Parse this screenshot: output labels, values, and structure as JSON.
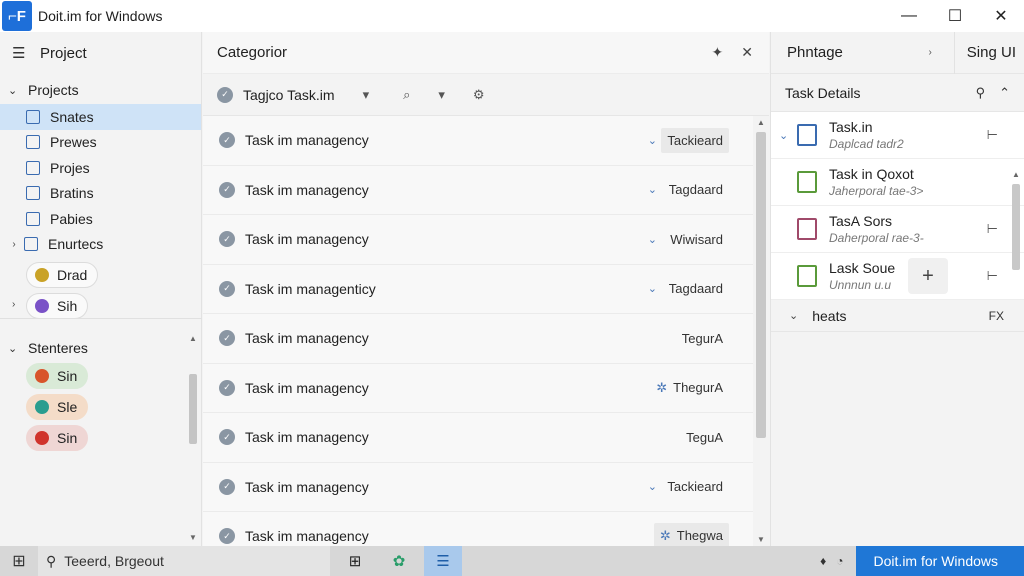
{
  "window": {
    "title": "Doit.im for Windows",
    "controls": [
      "—",
      "☐",
      "✕"
    ]
  },
  "sidebar": {
    "header": "Project",
    "projects_label": "Projects",
    "items": [
      {
        "label": "Snates",
        "selected": true
      },
      {
        "label": "Prewes",
        "selected": false
      },
      {
        "label": "Projes",
        "selected": false
      },
      {
        "label": "Bratins",
        "selected": false
      },
      {
        "label": "Pabies",
        "selected": false
      },
      {
        "label": "Enurtecs",
        "selected": false,
        "expandable": true
      }
    ],
    "pills_top": [
      {
        "label": "Drad",
        "color": "#c9a227"
      },
      {
        "label": "Sih",
        "color": "#7a52c7"
      }
    ],
    "stenters_label": "Stenteres",
    "pills_bottom": [
      {
        "label": "Sin",
        "bg": "#d9ead7",
        "color": "#d8552a"
      },
      {
        "label": "Sle",
        "bg": "#f4dcc8",
        "color": "#2a9d8f"
      },
      {
        "label": "Sin",
        "bg": "#efd6d4",
        "color": "#d0342c"
      }
    ]
  },
  "center": {
    "header_title": "Categorior",
    "header_pin": "✦",
    "header_close": "✕",
    "toolbar_label": "Tagjco Task.im",
    "toolbar_dropdown": "▾",
    "toolbar_search": "⌕",
    "toolbar_filter": "▾",
    "toolbar_settings": "⚙",
    "tasks": [
      {
        "name": "Task im managency",
        "tag": "Tackieard",
        "chev": true,
        "boxed": true,
        "tagicon": ""
      },
      {
        "name": "Task im managency",
        "tag": "Tagdaard",
        "chev": true,
        "boxed": false,
        "tagicon": ""
      },
      {
        "name": "Task im managency",
        "tag": "Wiwisard",
        "chev": true,
        "boxed": false,
        "tagicon": ""
      },
      {
        "name": "Task im managenticy",
        "tag": "Tagdaard",
        "chev": true,
        "boxed": false,
        "tagicon": ""
      },
      {
        "name": "Task im managency",
        "tag": "TegurA",
        "chev": false,
        "boxed": false,
        "tagicon": ""
      },
      {
        "name": "Task im managency",
        "tag": "ThegurA",
        "chev": false,
        "boxed": false,
        "tagicon": "✲"
      },
      {
        "name": "Task im managency",
        "tag": "TeguA",
        "chev": false,
        "boxed": false,
        "tagicon": ""
      },
      {
        "name": "Task im managency",
        "tag": "Tackieard",
        "chev": true,
        "boxed": false,
        "tagicon": ""
      },
      {
        "name": "Task im managency",
        "tag": "Thegwa",
        "chev": false,
        "boxed": true,
        "tagicon": "✲"
      }
    ]
  },
  "right": {
    "header_title": "Phntage",
    "header_mid": "›",
    "header_side": "Sing UI",
    "sub_title": "Task Details",
    "sub_pin": "⚲",
    "sub_collapse": "⌃",
    "details": [
      {
        "t1": "Task.in",
        "t2": "Daplcad tadr2",
        "border": "#3a6bb0",
        "flag": "⊢",
        "chev": true
      },
      {
        "t1": "Task in Qoxot",
        "t2": "Jaherporal tae-3>",
        "border": "#5a9a3a",
        "flag": "",
        "chev": false
      },
      {
        "t1": "TasA Sors",
        "t2": "Daherporal rae-3-",
        "border": "#a04a6a",
        "flag": "⊢",
        "chev": false
      },
      {
        "t1": "Lask Soue",
        "t2": "Unnnun u.u",
        "border": "#5a9a3a",
        "flag": "⊢",
        "chev": false,
        "plus": "+"
      }
    ],
    "group_label": "heats",
    "group_right": "FX"
  },
  "taskbar": {
    "start": "⊞",
    "search_icon": "⚲",
    "search_text": "Teeerd, Brgeout",
    "apps": [
      {
        "glyph": "⊞",
        "active": false
      },
      {
        "glyph": "✿",
        "active": false
      },
      {
        "glyph": "☰",
        "active": true
      }
    ],
    "tray": [
      "♦",
      "◔"
    ],
    "running_app": "Doit.im for Windows"
  }
}
